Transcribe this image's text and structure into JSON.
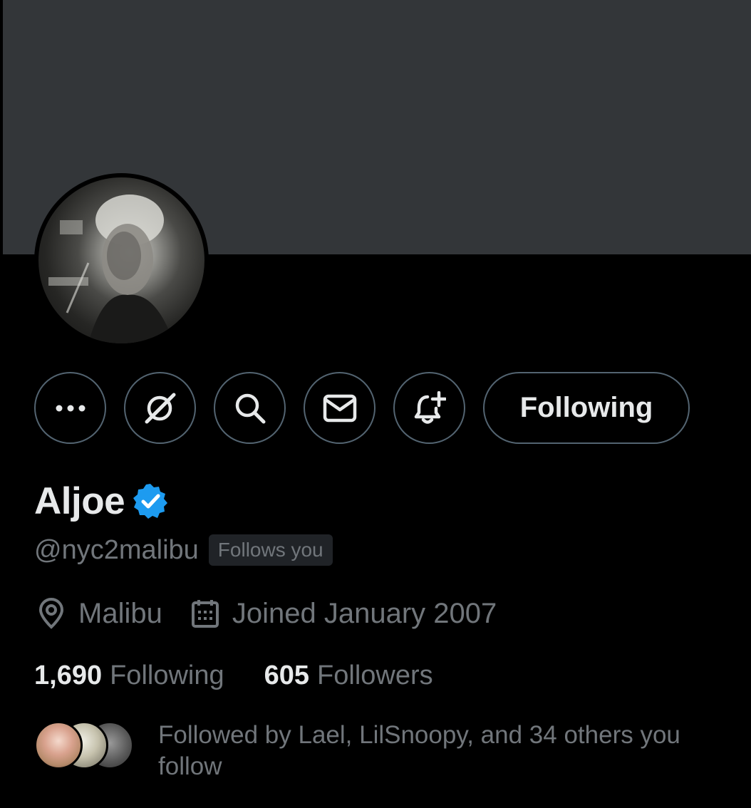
{
  "profile": {
    "display_name": "Aljoe",
    "handle": "@nyc2malibu",
    "follows_you_badge": "Follows you",
    "verified": true,
    "location": "Malibu",
    "joined": "Joined January 2007"
  },
  "actions": {
    "more_icon": "more-dots-icon",
    "grok_icon": "grok-icon",
    "search_icon": "search-icon",
    "message_icon": "envelope-icon",
    "notify_icon": "bell-plus-icon",
    "following_label": "Following"
  },
  "stats": {
    "following_count": "1,690",
    "following_label": "Following",
    "followers_count": "605",
    "followers_label": "Followers"
  },
  "followed_by": {
    "text": "Followed by Lael, LilSnoopy, and 34 others you follow"
  },
  "colors": {
    "background": "#000000",
    "banner": "#333639",
    "primary_text": "#e7e9ea",
    "secondary_text": "#71767b",
    "border": "#536471",
    "verified_badge": "#1d9bf0",
    "badge_bg": "#202327"
  }
}
